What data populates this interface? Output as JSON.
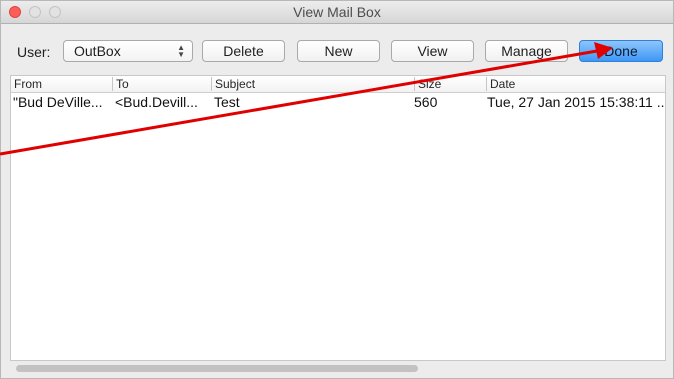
{
  "window": {
    "title": "View Mail Box"
  },
  "toolbar": {
    "user_label": "User:",
    "user_select_value": "OutBox",
    "buttons": [
      "Delete",
      "New",
      "View",
      "Manage",
      "Done"
    ]
  },
  "table": {
    "columns": [
      "From",
      "To",
      "Subject",
      "Size",
      "Date"
    ],
    "rows": [
      {
        "from": "\"Bud DeVille...",
        "to": "<Bud.Devill...",
        "subject": "Test",
        "size": "560",
        "date": "Tue, 27 Jan 2015 15:38:11 .."
      }
    ]
  },
  "colors": {
    "accent": "#3e97f6",
    "annotation_arrow": "#e00000"
  }
}
